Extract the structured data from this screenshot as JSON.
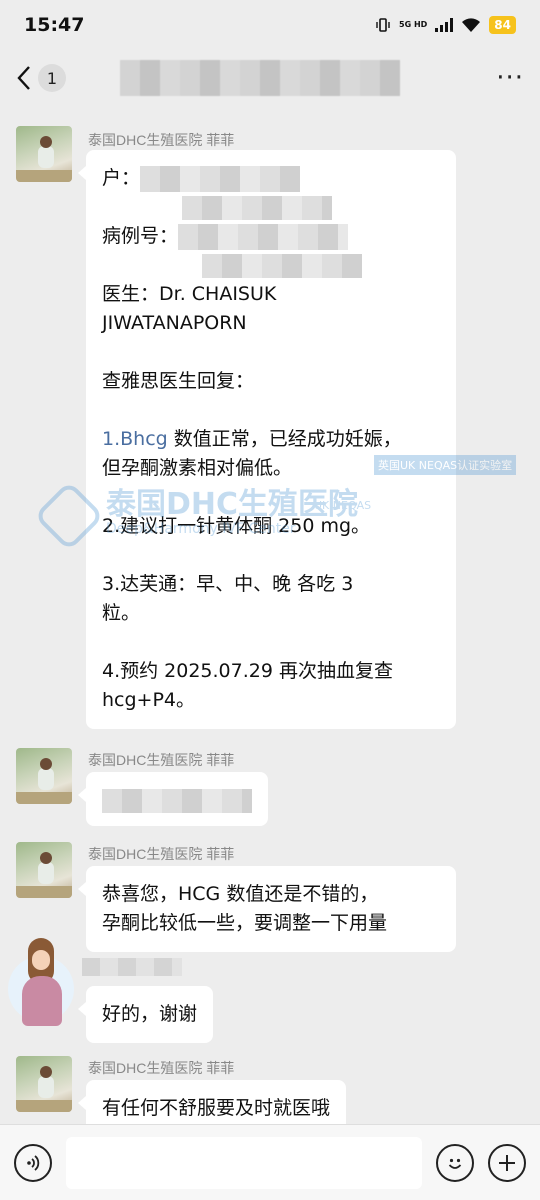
{
  "status_bar": {
    "time": "15:47",
    "network": "5G HD",
    "battery": "84"
  },
  "header": {
    "unread_count": "1",
    "more_label": "···"
  },
  "messages": [
    {
      "sender": "泰国DHC生殖医院   菲菲",
      "type": "report",
      "lines": {
        "account_label": "户：",
        "case_label": "病例号：",
        "doctor_line1": "医生：Dr. CHAISUK",
        "doctor_line2": "JIWATANAPORN",
        "reply_title": "查雅思医生回复：",
        "item1_prefix": "1.Bhcg",
        "item1_line1_rest": " 数值正常，已经成功妊娠，",
        "item1_line2": "但孕酮激素相对偏低。",
        "item2": "2.建议打一针黄体酮 250 mg。",
        "item3_line1": "3.达芙通：早、中、晚 各吃 3",
        "item3_line2": "粒。",
        "item4_line1": "4.预约 2025.07.29 再次抽血复查",
        "item4_line2": "hcg+P4。"
      }
    },
    {
      "sender": "泰国DHC生殖医院   菲菲",
      "type": "blurred"
    },
    {
      "sender": "泰国DHC生殖医院   菲菲",
      "line1": "恭喜您，HCG 数值还是不错的，",
      "line2": "孕酮比较低一些，要调整一下用量"
    },
    {
      "sender": "",
      "text": "好的，谢谢"
    },
    {
      "sender": "泰国DHC生殖医院   菲菲",
      "text": "有任何不舒服要及时就医哦"
    }
  ],
  "watermark": {
    "title": "泰国DHC生殖医院",
    "subtitle": "Deep&Harmony IVF Center",
    "tag": "英国UK NEQAS认证实验室",
    "tag2": "UK NEQAS"
  },
  "input": {
    "placeholder": ""
  }
}
